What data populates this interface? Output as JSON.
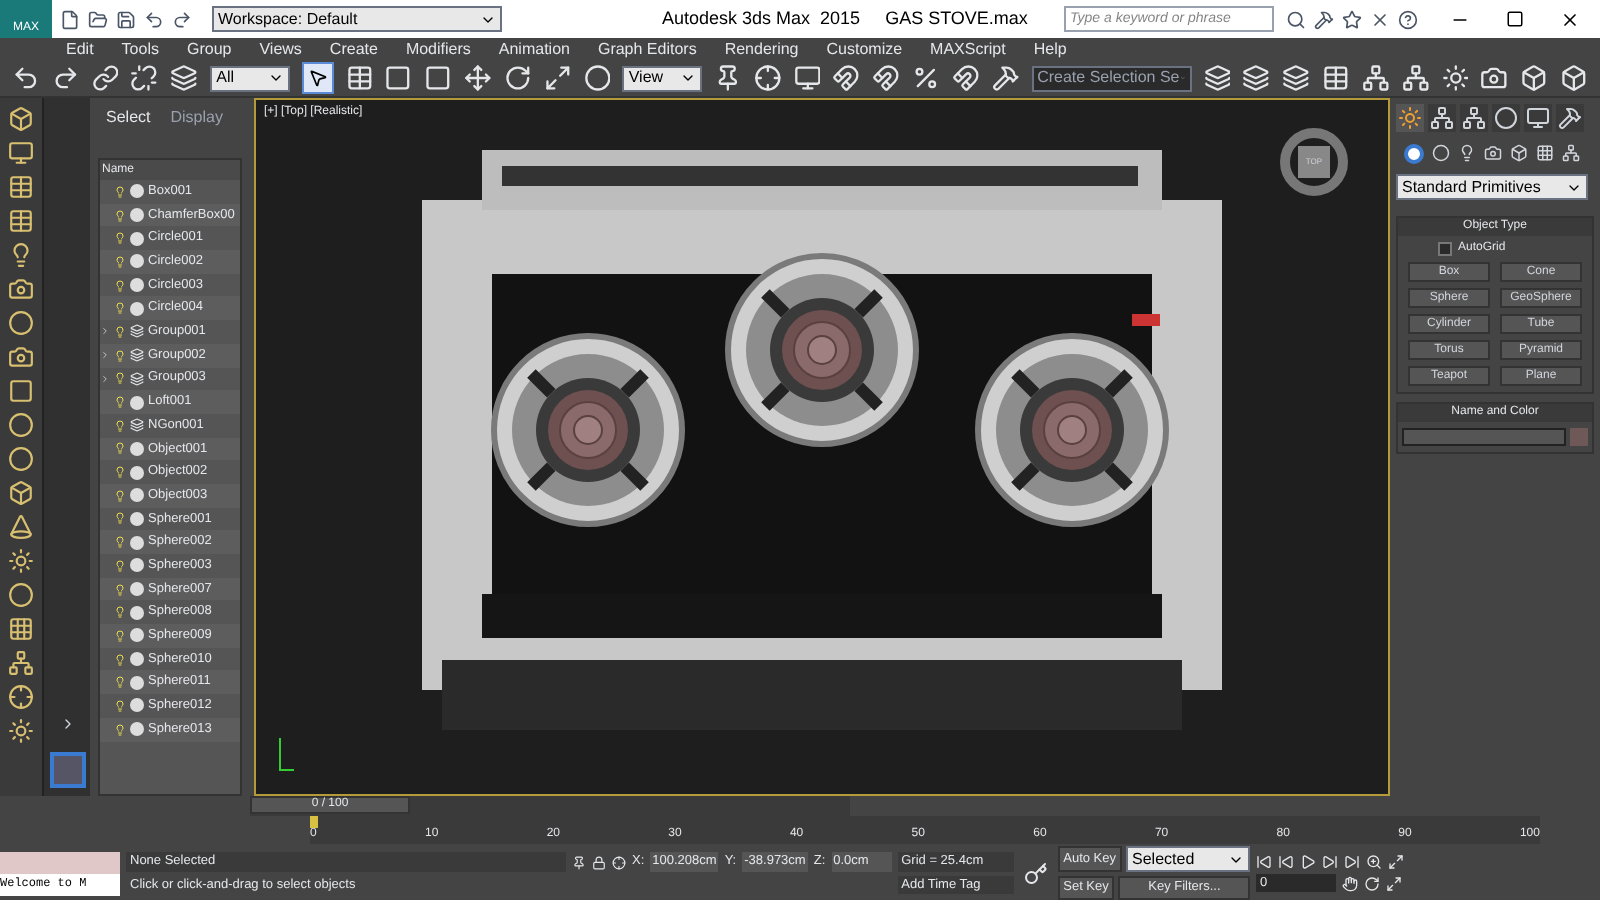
{
  "title_bar": {
    "app_badge": "MAX",
    "workspace": "Workspace: Default",
    "title": "Autodesk 3ds Max  2015     GAS STOVE.max",
    "search_placeholder": "Type a keyword or phrase"
  },
  "menu": [
    "Edit",
    "Tools",
    "Group",
    "Views",
    "Create",
    "Modifiers",
    "Animation",
    "Graph Editors",
    "Rendering",
    "Customize",
    "MAXScript",
    "Help"
  ],
  "toolbar": {
    "filter": "All",
    "ref_coord": "View",
    "selection_set": "Create Selection Se"
  },
  "scene_explorer": {
    "tabs": [
      {
        "label": "Select",
        "selected": true
      },
      {
        "label": "Display",
        "selected": false
      }
    ],
    "column": "Name",
    "items": [
      {
        "name": "Box001",
        "kind": "object"
      },
      {
        "name": "ChamferBox00",
        "kind": "object"
      },
      {
        "name": "Circle001",
        "kind": "object"
      },
      {
        "name": "Circle002",
        "kind": "object"
      },
      {
        "name": "Circle003",
        "kind": "object"
      },
      {
        "name": "Circle004",
        "kind": "object"
      },
      {
        "name": "Group001",
        "kind": "group"
      },
      {
        "name": "Group002",
        "kind": "group"
      },
      {
        "name": "Group003",
        "kind": "group"
      },
      {
        "name": "Loft001",
        "kind": "object"
      },
      {
        "name": "NGon001",
        "kind": "shape"
      },
      {
        "name": "Object001",
        "kind": "object"
      },
      {
        "name": "Object002",
        "kind": "object"
      },
      {
        "name": "Object003",
        "kind": "object"
      },
      {
        "name": "Sphere001",
        "kind": "object"
      },
      {
        "name": "Sphere002",
        "kind": "object"
      },
      {
        "name": "Sphere003",
        "kind": "object"
      },
      {
        "name": "Sphere007",
        "kind": "object"
      },
      {
        "name": "Sphere008",
        "kind": "object"
      },
      {
        "name": "Sphere009",
        "kind": "object"
      },
      {
        "name": "Sphere010",
        "kind": "object"
      },
      {
        "name": "Sphere011",
        "kind": "object"
      },
      {
        "name": "Sphere012",
        "kind": "object"
      },
      {
        "name": "Sphere013",
        "kind": "object"
      }
    ]
  },
  "viewport": {
    "label": "[+] [Top] [Realistic]",
    "viewcube": "TOP"
  },
  "command_panel": {
    "dropdown": "Standard Primitives",
    "object_type": {
      "title": "Object Type",
      "autogrid": {
        "label": "AutoGrid",
        "checked": false
      },
      "buttons": [
        "Box",
        "Cone",
        "Sphere",
        "GeoSphere",
        "Cylinder",
        "Tube",
        "Torus",
        "Pyramid",
        "Teapot",
        "Plane"
      ]
    },
    "name_and_color": {
      "title": "Name and Color",
      "color": "#6e5858"
    }
  },
  "timeline": {
    "slider": "0 / 100",
    "level": 0,
    "ticks": [
      "0",
      "10",
      "20",
      "30",
      "40",
      "50",
      "60",
      "70",
      "80",
      "90",
      "100"
    ]
  },
  "status": {
    "maxscript": "Welcome to M",
    "selection": "None Selected",
    "prompt": "Click or click-and-drag to select objects",
    "x_label": "X:",
    "x": "100.208cm",
    "y_label": "Y:",
    "y": "-38.973cm",
    "z_label": "Z:",
    "z": "0.0cm",
    "grid": "Grid = 25.4cm",
    "time_tag": "Add Time Tag",
    "auto_key": "Auto Key",
    "key_mode": "Selected",
    "set_key": "Set Key",
    "key_filters": "Key Filters...",
    "frame": "0"
  }
}
